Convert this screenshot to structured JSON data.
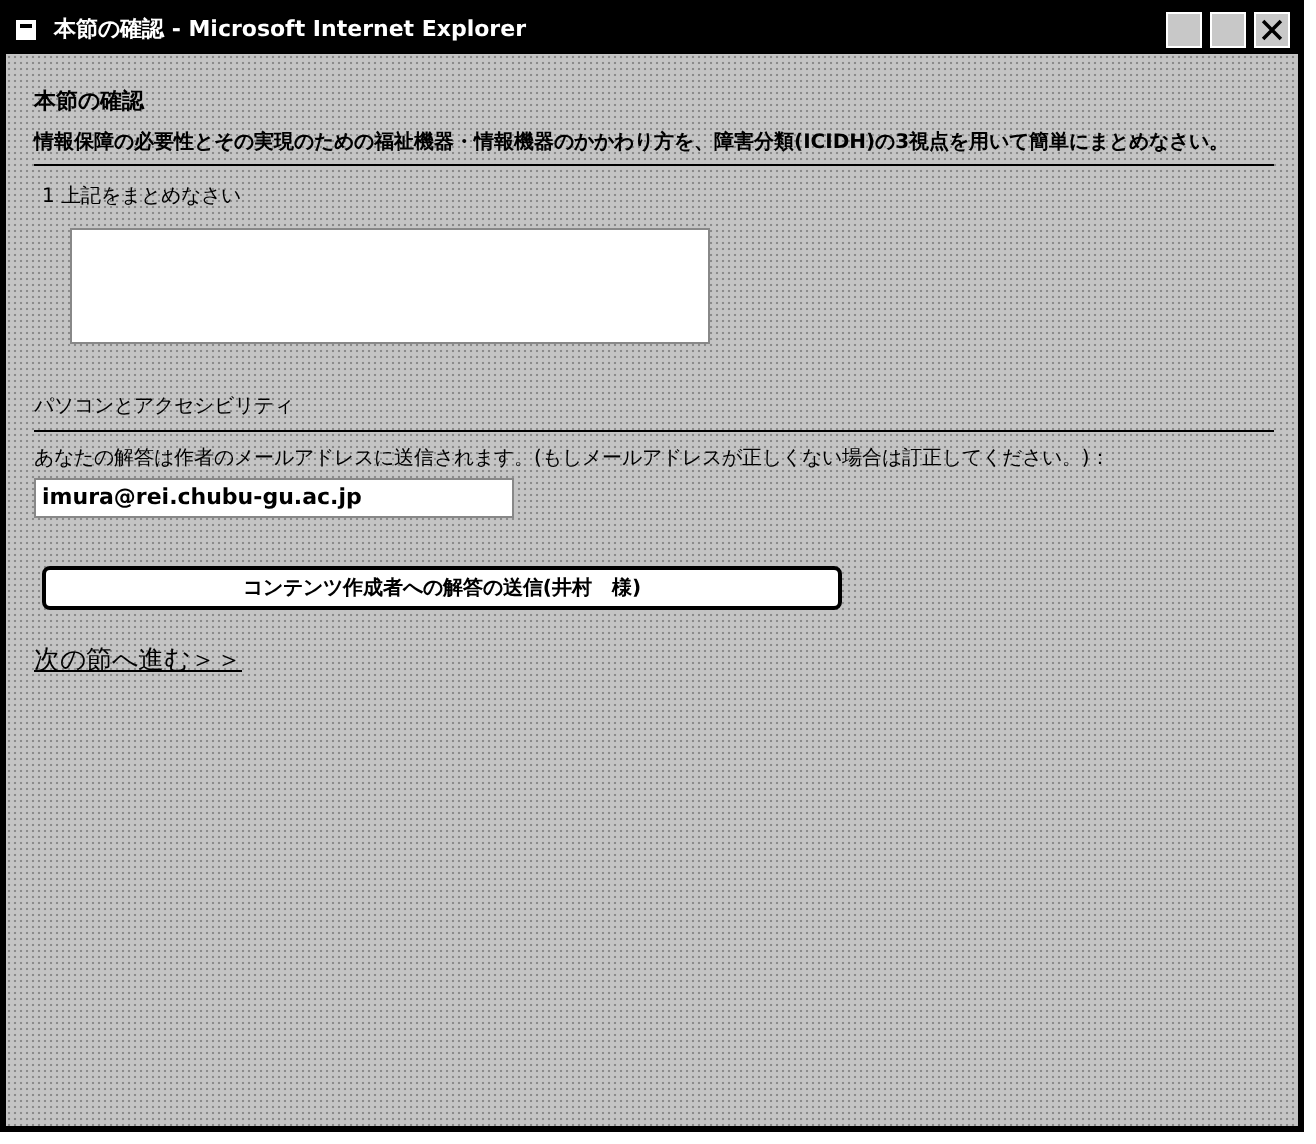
{
  "window": {
    "title": "本節の確認 - Microsoft Internet Explorer"
  },
  "heading": "本節の確認",
  "instruction": "情報保障の必要性とその実現のための福祉機器・情報機器のかかわり方を、障害分類(ICIDH)の3視点を用いて簡単にまとめなさい。",
  "question": {
    "label": "1 上記をまとめなさい"
  },
  "section_title": "パソコンとアクセシビリティ",
  "notice": "あなたの解答は作者のメールアドレスに送信されます。(もしメールアドレスが正しくない場合は訂正してください。)：",
  "email": {
    "value": "imura@rei.chubu-gu.ac.jp"
  },
  "send_button": "コンテンツ作成者への解答の送信(井村　様)",
  "next_link": "次の節へ進む＞＞"
}
